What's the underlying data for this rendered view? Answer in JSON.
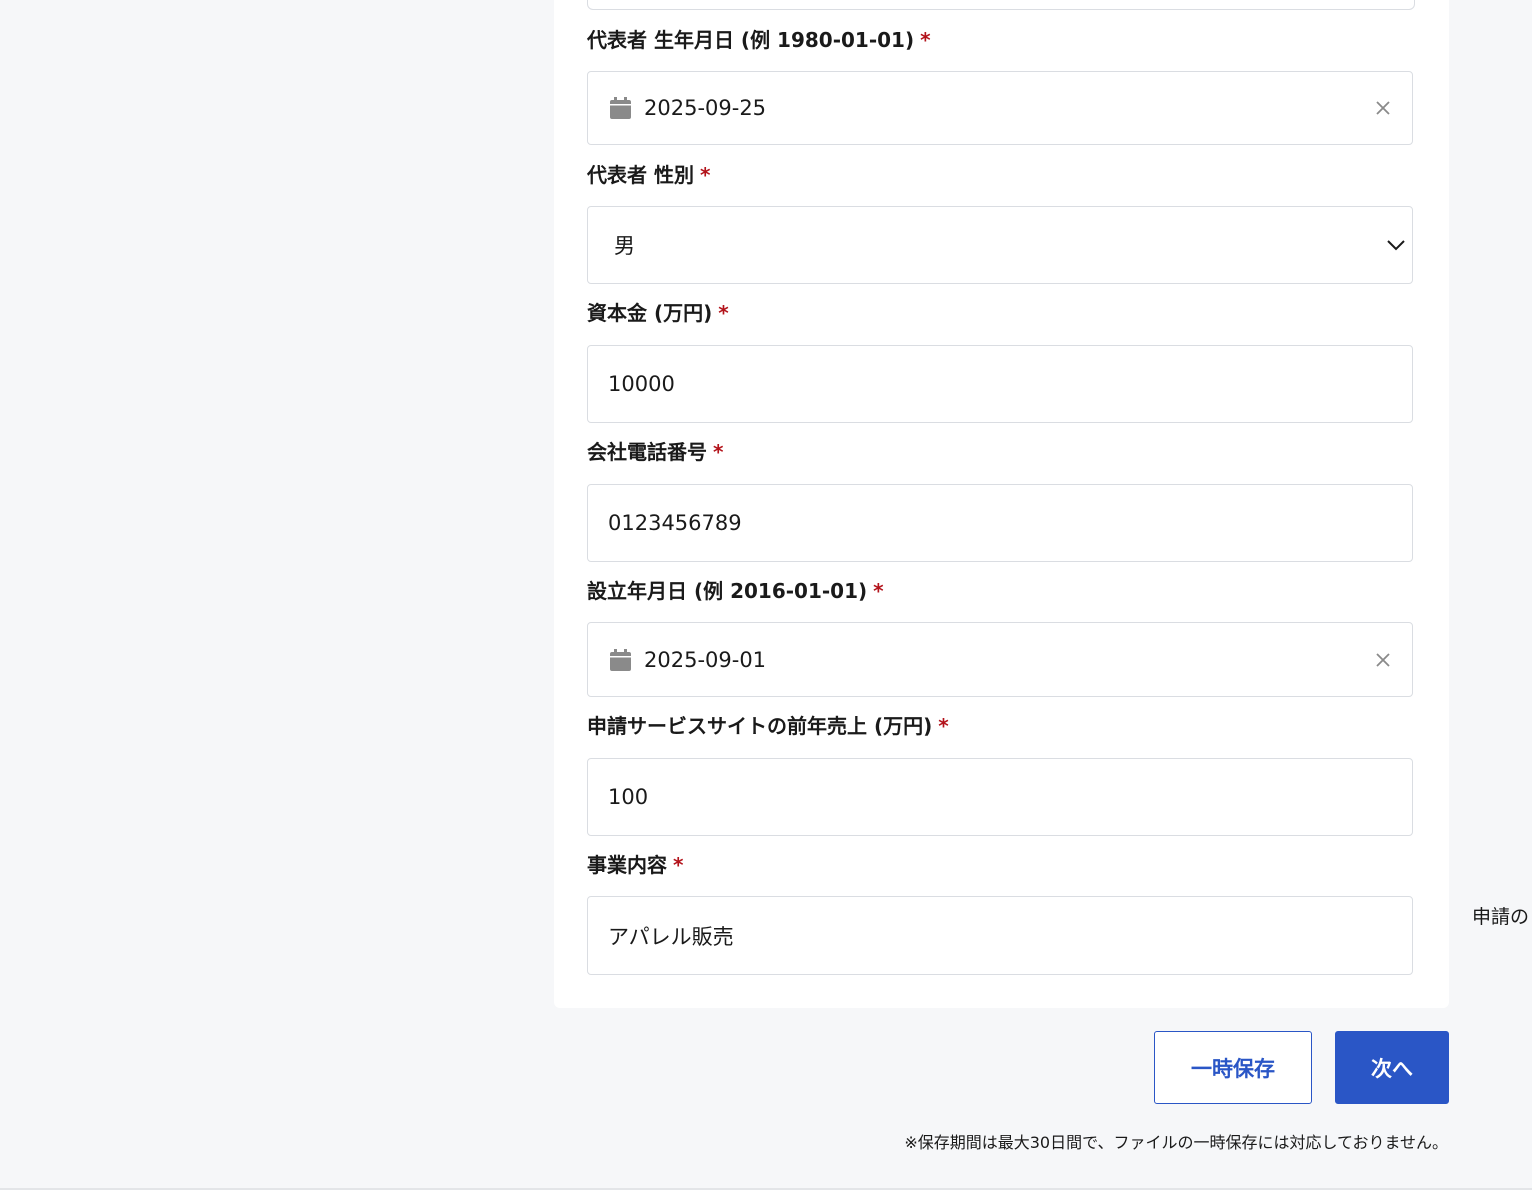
{
  "form": {
    "fields": [
      {
        "label": "代表者 生年月日 (例 1980-01-01)",
        "required_mark": "*",
        "value": "2025-09-25"
      },
      {
        "label": "代表者 性別",
        "required_mark": "*",
        "value": "男"
      },
      {
        "label": "資本金 (万円)",
        "required_mark": "*",
        "value": "10000"
      },
      {
        "label": "会社電話番号",
        "required_mark": "*",
        "value": "0123456789"
      },
      {
        "label": "設立年月日 (例 2016-01-01)",
        "required_mark": "*",
        "value": "2025-09-01"
      },
      {
        "label": "申請サービスサイトの前年売上 (万円)",
        "required_mark": "*",
        "value": "100"
      },
      {
        "label": "事業内容",
        "required_mark": "*",
        "value": "アパレル販売"
      }
    ]
  },
  "actions": {
    "save_label": "一時保存",
    "next_label": "次へ"
  },
  "note": "※保存期間は最大30日間で、ファイルの一時保存には対応しておりません。",
  "side_text": "申請の",
  "colors": {
    "primary": "#2a56c6",
    "required": "#b3131b",
    "background": "#f6f7f9"
  },
  "icons": {
    "date": "calendar-icon",
    "clear": "close-icon",
    "select": "chevron-down-icon"
  }
}
